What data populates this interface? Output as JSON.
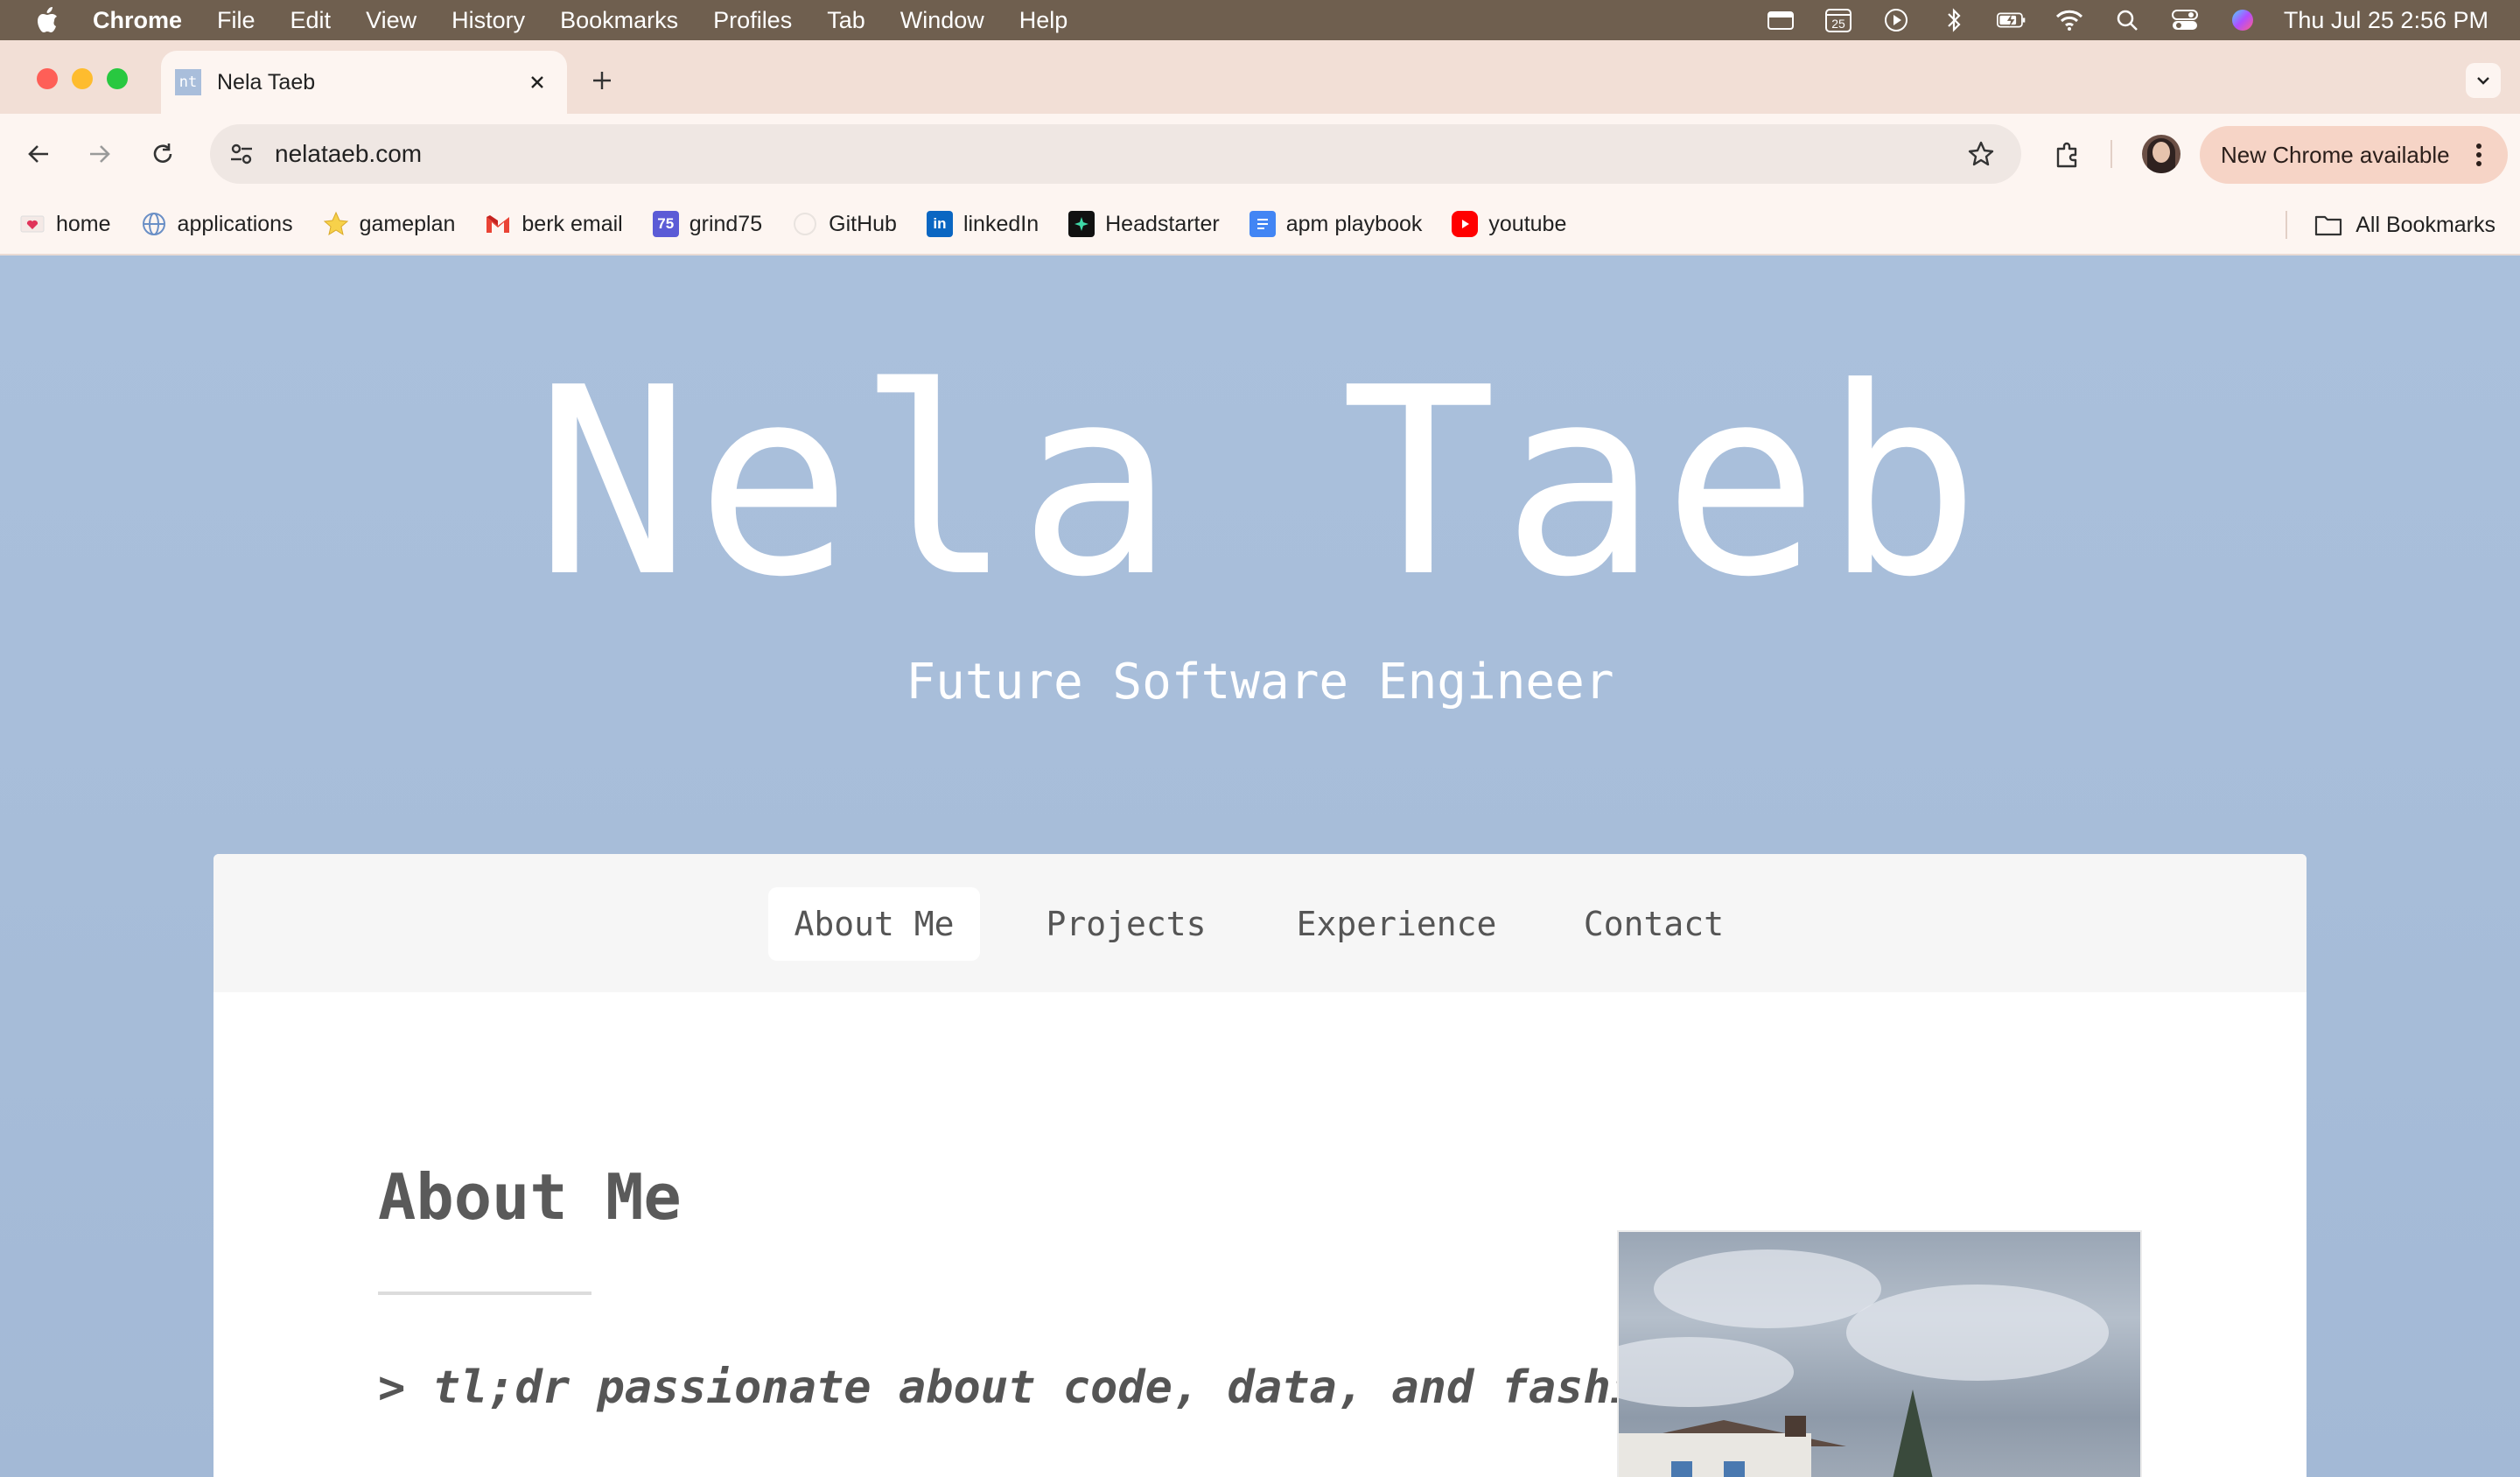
{
  "menubar": {
    "app_name": "Chrome",
    "items": [
      "File",
      "Edit",
      "View",
      "History",
      "Bookmarks",
      "Profiles",
      "Tab",
      "Window",
      "Help"
    ],
    "calendar_day": "25",
    "clock": "Thu Jul 25  2:56 PM"
  },
  "browser": {
    "tab": {
      "title": "Nela Taeb",
      "favicon_text": "nt"
    },
    "url": "nelataeb.com",
    "update_label": "New Chrome available"
  },
  "bookmarks": {
    "items": [
      {
        "label": "home",
        "icon": "heart-card-icon"
      },
      {
        "label": "applications",
        "icon": "globe-icon"
      },
      {
        "label": "gameplan",
        "icon": "star-icon"
      },
      {
        "label": "berk email",
        "icon": "gmail-icon"
      },
      {
        "label": "grind75",
        "icon": "grind75-icon",
        "icon_text": "75"
      },
      {
        "label": "GitHub",
        "icon": "github-icon"
      },
      {
        "label": "linkedIn",
        "icon": "linkedin-icon",
        "icon_text": "in"
      },
      {
        "label": "Headstarter",
        "icon": "headstarter-icon"
      },
      {
        "label": "apm playbook",
        "icon": "docs-icon"
      },
      {
        "label": "youtube",
        "icon": "youtube-icon"
      }
    ],
    "all_label": "All Bookmarks"
  },
  "hero": {
    "name": "Nela Taeb",
    "subtitle": "Future Software Engineer"
  },
  "nav": {
    "tabs": [
      "About Me",
      "Projects",
      "Experience",
      "Contact"
    ],
    "active": "About Me"
  },
  "about": {
    "title": "About Me",
    "tldr": "> tl;dr passionate about code, data, and fashion"
  },
  "colors": {
    "page_background": "#a9bedb",
    "menubar": "#6f5f4f",
    "tab_strip": "#f2dfd6",
    "toolbar": "#fdf5f1",
    "update_button": "#f6d4c6"
  }
}
